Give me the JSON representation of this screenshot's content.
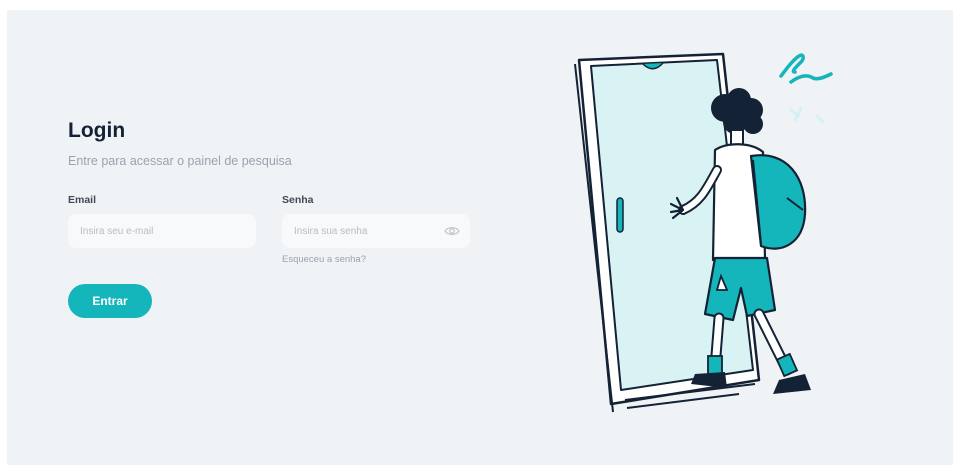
{
  "login": {
    "title": "Login",
    "subtitle": "Entre para acessar o painel de pesquisa",
    "email": {
      "label": "Email",
      "placeholder": "Insira seu e-mail",
      "value": ""
    },
    "password": {
      "label": "Senha",
      "placeholder": "Insira sua senha",
      "value": "",
      "toggle_icon": "eye-icon"
    },
    "forgot_link": "Esqueceu a senha?",
    "submit_label": "Entrar"
  },
  "illustration": {
    "subject": "person-walking-through-phone-door",
    "icon": "phone-door-illustration"
  },
  "colors": {
    "accent": "#14b5bb",
    "background": "#f0f3f6",
    "title": "#142235",
    "muted": "#9aa3ad"
  }
}
